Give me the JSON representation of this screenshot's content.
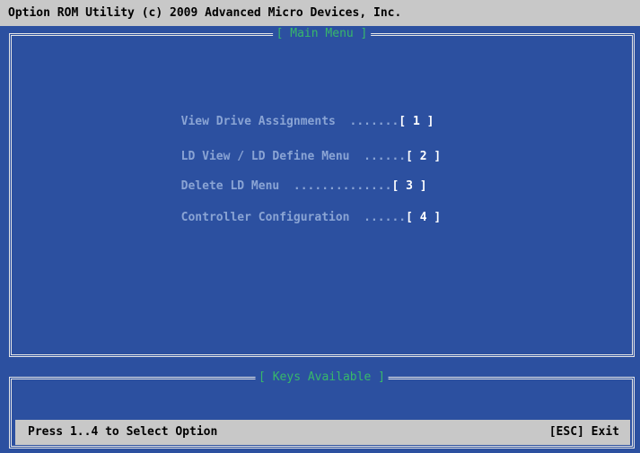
{
  "title": "Option ROM Utility (c) 2009 Advanced Micro Devices, Inc.",
  "main_menu": {
    "frame_title": "[ Main Menu ]",
    "items": [
      {
        "label": "View Drive Assignments",
        "dots": "  .......",
        "key": "[ 1 ]"
      },
      {
        "label": "LD View / LD Define Menu",
        "dots": "  ......",
        "key": "[ 2 ]"
      },
      {
        "label": "Delete LD Menu",
        "dots": "  ..............",
        "key": "[ 3 ]"
      },
      {
        "label": "Controller Configuration",
        "dots": "  ......",
        "key": "[ 4 ]"
      }
    ]
  },
  "keys": {
    "frame_title": "[ Keys Available ]",
    "hint": "Press 1..4 to Select Option",
    "exit": "[ESC] Exit"
  },
  "colors": {
    "background": "#2c50a0",
    "title_bar": "#c8c8c8",
    "frame_title": "#38b86a",
    "menu_label": "#8aa4d4",
    "menu_key": "#ffffff"
  }
}
